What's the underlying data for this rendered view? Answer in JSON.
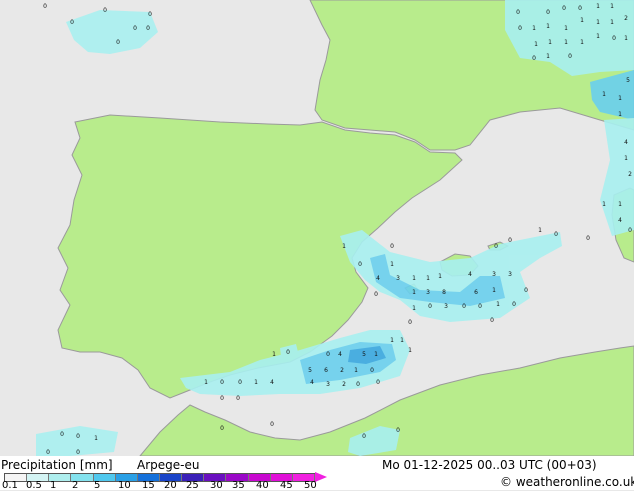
{
  "colors": {
    "sea": "#e8e8e8",
    "land": "#b8ec8c",
    "coast": "#9a9a9a",
    "precip_light": "#a8f0f0",
    "precip_mid": "#6ad0ee",
    "precip_heavy": "#3aa8e0"
  },
  "map": {
    "precip_labels": [
      "0",
      "1",
      "2",
      "3",
      "4",
      "5",
      "6",
      "8"
    ]
  },
  "legend": {
    "title": "Precipitation [mm]",
    "model": "Arpege-eu",
    "scale": [
      "0.1",
      "0.5",
      "1",
      "2",
      "5",
      "10",
      "15",
      "20",
      "25",
      "30",
      "35",
      "40",
      "45",
      "50"
    ],
    "swatches": [
      "#f5f5f5",
      "#d4f4f4",
      "#aeeeee",
      "#84e2ee",
      "#50c8ee",
      "#2aa0e6",
      "#1470da",
      "#1a44c8",
      "#3a20b8",
      "#6a10c0",
      "#9a08c8",
      "#c808d0",
      "#e010d8",
      "#f020e0"
    ]
  },
  "timestamp": "Mo 01-12-2025 00..03 UTC (00+03)",
  "credit": "© weatheronline.co.uk"
}
